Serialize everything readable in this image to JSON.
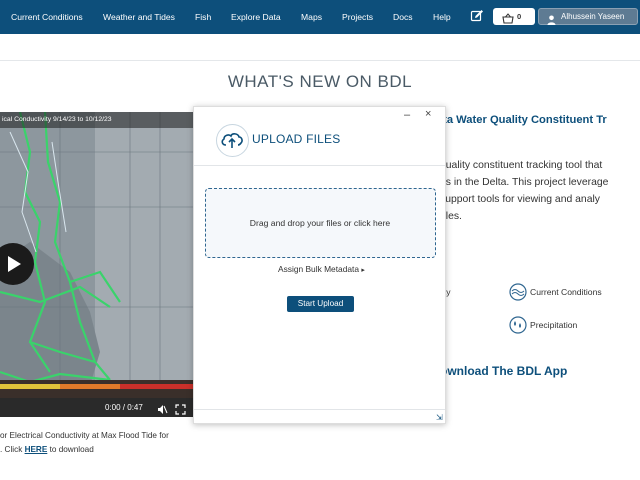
{
  "nav": {
    "items": [
      "Current Conditions",
      "Weather and Tides",
      "Fish",
      "Explore Data",
      "Maps",
      "Projects",
      "Docs",
      "Help"
    ],
    "cart_count": "0",
    "user_name": "Alhussein Yaseen",
    "icons": [
      "edit-icon",
      "basket-icon",
      "user-icon"
    ]
  },
  "page": {
    "heading": "WHAT'S NEW ON BDL"
  },
  "video": {
    "title": "ical Conductivity 9/14/23 to 10/12/23",
    "time": "0:00 / 0:47",
    "caption_line1": "or Electrical Conductivity at Max Flood Tide for",
    "caption_line2_prefix": ". Click ",
    "caption_link": "HERE",
    "caption_line2_suffix": " to download"
  },
  "right": {
    "title": "lta Water Quality Constituent Tr",
    "para": [
      "quality constituent tracking tool that",
      "ns in the Delta. This project leverage",
      "support tools for viewing and analy",
      "ales."
    ],
    "features": [
      "lity",
      "Current Conditions",
      "Precipitation"
    ],
    "download": "ownload The BDL App"
  },
  "dialog": {
    "minimize": "–",
    "close": "×",
    "title": "UPLOAD FILES",
    "drop_text": "Drag and drop your files or click here",
    "bulk": "Assign Bulk Metadata",
    "start": "Start Upload"
  },
  "colors": {
    "nav_bg": "#0d4f7b",
    "accent": "#0d4f7b",
    "map_green": "#3ad36b"
  }
}
